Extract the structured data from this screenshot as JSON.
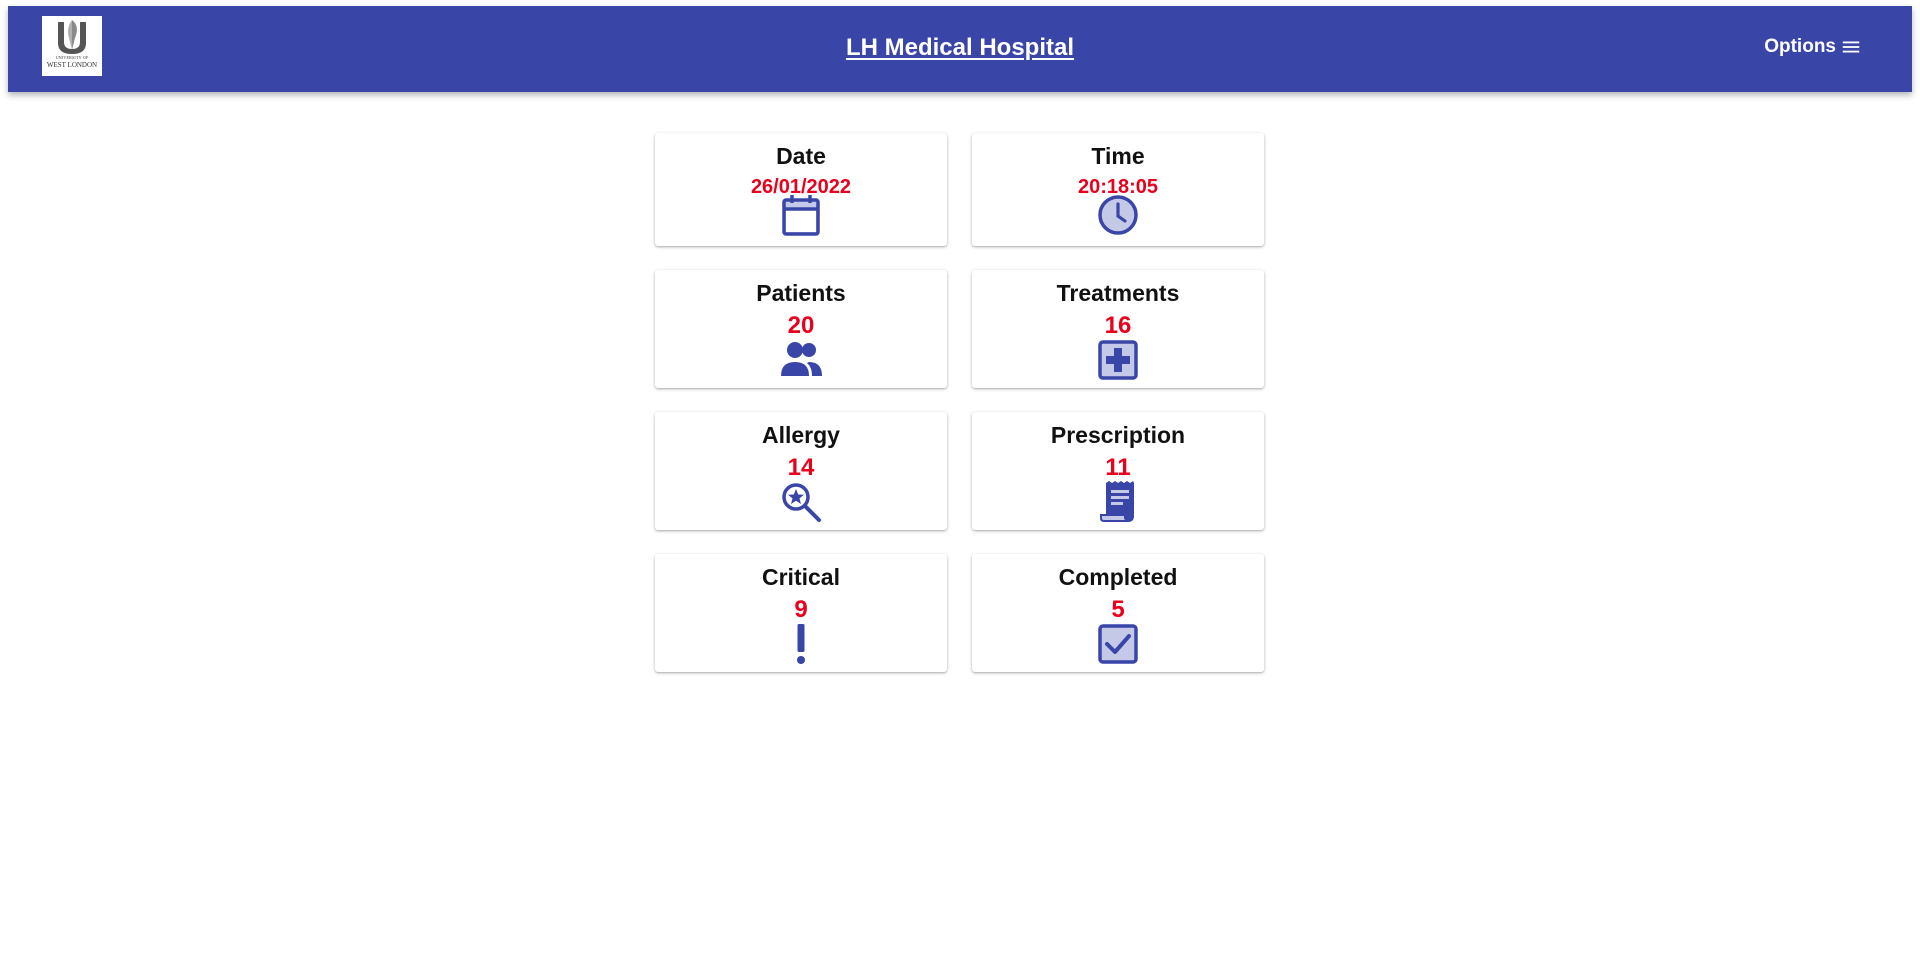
{
  "header": {
    "title": "LH Medical Hospital",
    "options_label": "Options",
    "logo": {
      "line1": "UNIVERSITY OF",
      "line2": "WEST LONDON"
    }
  },
  "cards": [
    {
      "title": "Date",
      "value": "26/01/2022",
      "icon": "calendar-icon"
    },
    {
      "title": "Time",
      "value": "20:18:05",
      "icon": "clock-icon"
    },
    {
      "title": "Patients",
      "value": "20",
      "icon": "people-icon"
    },
    {
      "title": "Treatments",
      "value": "16",
      "icon": "medical-plus-icon"
    },
    {
      "title": "Allergy",
      "value": "14",
      "icon": "search-star-icon"
    },
    {
      "title": "Prescription",
      "value": "11",
      "icon": "receipt-icon"
    },
    {
      "title": "Critical",
      "value": "9",
      "icon": "exclamation-icon"
    },
    {
      "title": "Completed",
      "value": "5",
      "icon": "checkbox-icon"
    }
  ],
  "colors": {
    "header_bg": "#3a45a8",
    "accent": "#3a45a8",
    "value_red": "#e8001c"
  }
}
